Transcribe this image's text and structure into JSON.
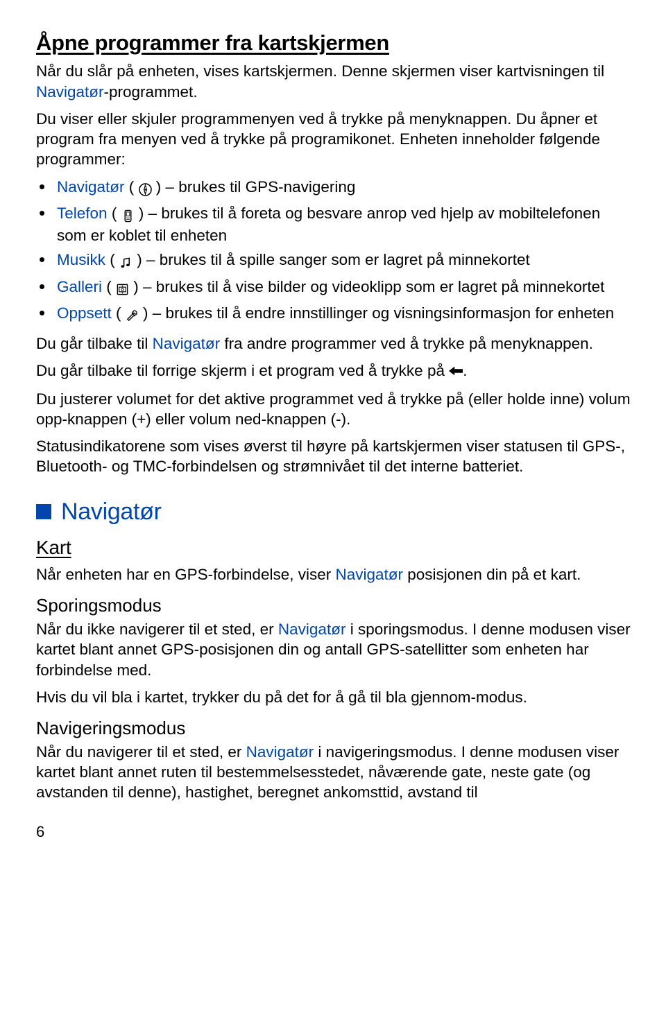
{
  "h1": "Åpne programmer fra kartskjermen",
  "p1_a": "Når du slår på enheten, vises kartskjermen. Denne skjermen viser kartvisningen til ",
  "p1_link": "Navigatør",
  "p1_b": "-programmet.",
  "p2": "Du viser eller skjuler programmenyen ved å trykke på menyknappen. Du åpner et program fra menyen ved å trykke på programikonet. Enheten inneholder følgende programmer:",
  "items": {
    "nav": {
      "name": "Navigatør",
      "trail": " ( ",
      "desc": " ) – brukes til GPS-navigering"
    },
    "tel": {
      "name": "Telefon",
      "trail": " ( ",
      "desc": " ) – brukes til å foreta og besvare anrop ved hjelp av mobiltelefonen som er koblet til enheten"
    },
    "mus": {
      "name": "Musikk",
      "trail": " ( ",
      "desc": " ) – brukes til å spille sanger som er lagret på minnekortet"
    },
    "gal": {
      "name": "Galleri",
      "trail": " ( ",
      "desc": " ) – brukes til å vise bilder og videoklipp som er lagret på minnekortet"
    },
    "opp": {
      "name": "Oppsett",
      "trail": " ( ",
      "desc": " ) – brukes til å endre innstillinger og visningsinformasjon for enheten"
    }
  },
  "p3_a": "Du går tilbake til ",
  "p3_link": "Navigatør",
  "p3_b": " fra andre programmer ved å trykke på menyknappen.",
  "p4_a": "Du går tilbake til forrige skjerm i et program ved å trykke på ",
  "p4_b": ".",
  "p5": "Du justerer volumet for det aktive programmet ved å trykke på (eller holde inne) volum opp-knappen (+) eller volum ned-knappen (-).",
  "p6": "Statusindikatorene som vises øverst til høyre på kartskjermen viser statusen til GPS-, Bluetooth- og TMC-forbindelsen og strømnivået til det interne batteriet.",
  "h2": "Navigatør",
  "kart": {
    "h": "Kart",
    "p_a": "Når enheten har en GPS-forbindelse, viser ",
    "p_link": "Navigatør",
    "p_b": " posisjonen din på et kart."
  },
  "spor": {
    "h": "Sporingsmodus",
    "p1_a": "Når du ikke navigerer til et sted, er ",
    "p1_link": "Navigatør",
    "p1_b": " i sporingsmodus. I denne modusen viser kartet blant annet GPS-posisjonen din og antall GPS-satellitter som enheten har forbindelse med.",
    "p2": "Hvis du vil bla i kartet, trykker du på det for å gå til bla gjennom-modus."
  },
  "nav2": {
    "h": "Navigeringsmodus",
    "p_a": "Når du navigerer til et sted, er ",
    "p_link": "Navigatør",
    "p_b": " i navigeringsmodus. I denne modusen viser kartet blant annet ruten til bestemmelsesstedet, nåværende gate, neste gate (og avstanden til denne), hastighet, beregnet ankomsttid, avstand til"
  },
  "page_num": "6"
}
